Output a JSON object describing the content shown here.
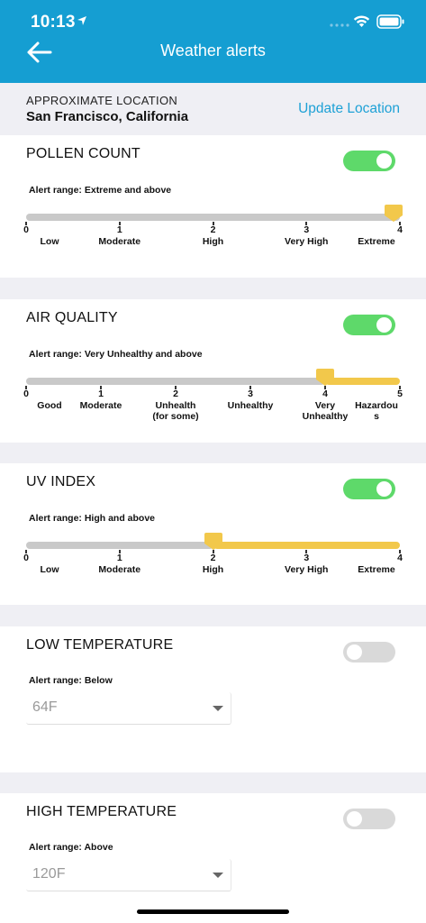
{
  "status": {
    "time": "10:13",
    "icons": [
      "location-arrow-icon",
      "cellular-dots-icon",
      "wifi-icon",
      "battery-icon"
    ]
  },
  "nav": {
    "title": "Weather alerts",
    "back_icon": "back-arrow-icon"
  },
  "location": {
    "label": "APPROXIMATE LOCATION",
    "value": "San Francisco, California",
    "update_label": "Update Location"
  },
  "colors": {
    "primary": "#159ed2",
    "toggle_on": "#5ed96a",
    "toggle_off": "#d9d9d9",
    "slider_active": "#f2c84b",
    "slider_track": "#c9c9c9",
    "link": "#1ea1d6"
  },
  "pollen": {
    "title": "POLLEN COUNT",
    "enabled": true,
    "range_text": "Alert range: Extreme and above",
    "selected_index": 4,
    "ticks": [
      {
        "num": "0",
        "name": "Low"
      },
      {
        "num": "1",
        "name": "Moderate"
      },
      {
        "num": "2",
        "name": "High"
      },
      {
        "num": "3",
        "name": "Very High"
      },
      {
        "num": "4",
        "name": "Extreme"
      }
    ]
  },
  "air": {
    "title": "AIR QUALITY",
    "enabled": true,
    "range_text": "Alert range: Very Unhealthy and above",
    "selected_index": 4,
    "ticks": [
      {
        "num": "0",
        "name": "Good"
      },
      {
        "num": "1",
        "name": "Moderate"
      },
      {
        "num": "2",
        "name": "Unhealth",
        "name2": "(for some)"
      },
      {
        "num": "3",
        "name": "Unhealthy"
      },
      {
        "num": "4",
        "name": "Very",
        "name2": "Unhealthy"
      },
      {
        "num": "5",
        "name": "Hazardou",
        "name2": "s"
      }
    ]
  },
  "uv": {
    "title": "UV INDEX",
    "enabled": true,
    "range_text": "Alert range: High and above",
    "selected_index": 2,
    "ticks": [
      {
        "num": "0",
        "name": "Low"
      },
      {
        "num": "1",
        "name": "Moderate"
      },
      {
        "num": "2",
        "name": "High"
      },
      {
        "num": "3",
        "name": "Very High"
      },
      {
        "num": "4",
        "name": "Extreme"
      }
    ]
  },
  "low_temp": {
    "title": "LOW TEMPERATURE",
    "enabled": false,
    "range_text": "Alert range: Below",
    "value": "64F"
  },
  "high_temp": {
    "title": "HIGH TEMPERATURE",
    "enabled": false,
    "range_text": "Alert range: Above",
    "value": "120F"
  }
}
